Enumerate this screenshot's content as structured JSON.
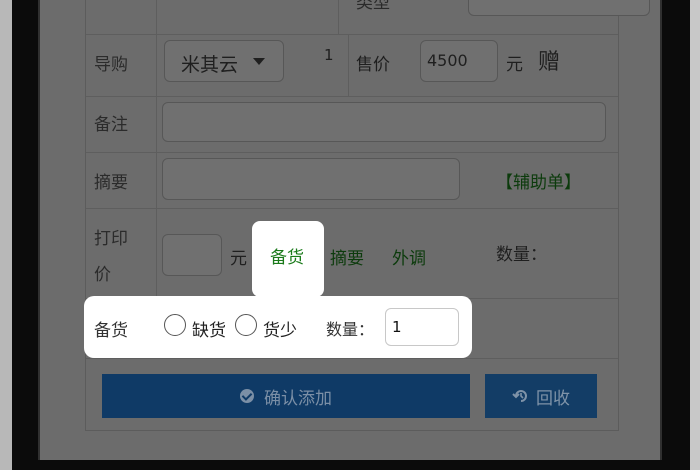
{
  "form": {
    "top_label_partial": "类型",
    "guide_label": "导购",
    "guide_select_value": "米其云",
    "guide_count": "1",
    "price_label": "售价",
    "price_value": "4500",
    "price_unit": "元",
    "gift_label": "赠",
    "note_label": "备注",
    "summary_label": "摘要",
    "aux_link": "【辅助单】",
    "print_price_label_1": "打印",
    "print_price_label_2": "价",
    "print_price_unit": "元",
    "tabs": [
      {
        "label": "备货",
        "active": true
      },
      {
        "label": "摘要",
        "active": false
      },
      {
        "label": "外调",
        "active": false
      }
    ],
    "quantity_right_label": "数量：",
    "stock_panel": {
      "label": "备货",
      "options": [
        "缺货",
        "货少"
      ],
      "quantity_label": "数量：",
      "quantity_value": "1"
    }
  },
  "buttons": {
    "confirm_label": "确认添加",
    "recycle_label": "回收"
  },
  "colors": {
    "accent_green": "#1a7a1a",
    "primary_blue": "#0f3a66"
  }
}
